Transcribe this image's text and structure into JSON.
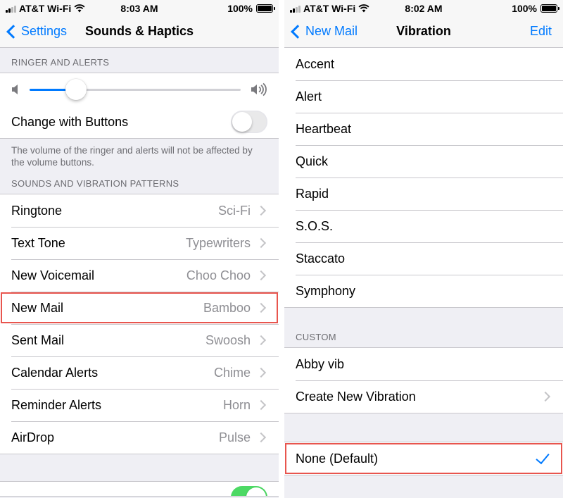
{
  "left": {
    "status": {
      "carrier": "AT&T Wi-Fi",
      "time": "8:03 AM",
      "battery": "100%"
    },
    "nav": {
      "back_label": "Settings",
      "title": "Sounds & Haptics"
    },
    "ringer_header": "RINGER AND ALERTS",
    "ringer_volume_level": 0.22,
    "change_with_buttons": {
      "label": "Change with Buttons",
      "on": false
    },
    "ringer_note": "The volume of the ringer and alerts will not be affected by the volume buttons.",
    "patterns_header": "SOUNDS AND VIBRATION PATTERNS",
    "patterns": [
      {
        "label": "Ringtone",
        "value": "Sci-Fi"
      },
      {
        "label": "Text Tone",
        "value": "Typewriters"
      },
      {
        "label": "New Voicemail",
        "value": "Choo Choo"
      },
      {
        "label": "New Mail",
        "value": "Bamboo",
        "highlighted": true
      },
      {
        "label": "Sent Mail",
        "value": "Swoosh"
      },
      {
        "label": "Calendar Alerts",
        "value": "Chime"
      },
      {
        "label": "Reminder Alerts",
        "value": "Horn"
      },
      {
        "label": "AirDrop",
        "value": "Pulse"
      }
    ]
  },
  "right": {
    "status": {
      "carrier": "AT&T Wi-Fi",
      "time": "8:02 AM",
      "battery": "100%"
    },
    "nav": {
      "back_label": "New Mail",
      "title": "Vibration",
      "edit_label": "Edit"
    },
    "standard": [
      "Accent",
      "Alert",
      "Heartbeat",
      "Quick",
      "Rapid",
      "S.O.S.",
      "Staccato",
      "Symphony"
    ],
    "custom_header": "CUSTOM",
    "custom": [
      {
        "label": "Abby vib"
      },
      {
        "label": "Create New Vibration",
        "chevron": true
      }
    ],
    "none_option": {
      "label": "None (Default)",
      "selected": true
    }
  },
  "colors": {
    "accent": "#007aff",
    "highlight": "#e8554e",
    "toggle_on": "#4cd964"
  },
  "icons": [
    "signal-icon",
    "wifi-icon",
    "battery-icon",
    "chevron-left-icon",
    "chevron-right-icon",
    "speaker-low-icon",
    "speaker-high-icon",
    "checkmark-icon"
  ]
}
